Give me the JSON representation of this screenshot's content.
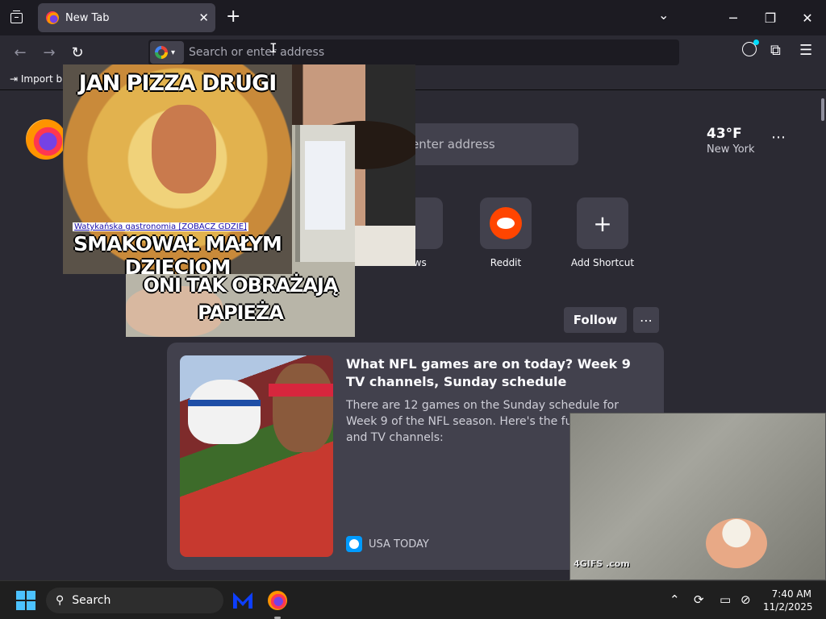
{
  "tabstrip": {
    "tab_title": "New Tab"
  },
  "navbar": {
    "url_placeholder": "Search or enter address"
  },
  "bookmarks": {
    "import_label": "Import b"
  },
  "newtab": {
    "search_placeholder": "enter address",
    "weather": {
      "temp": "43°F",
      "city": "New York"
    },
    "shortcuts": [
      {
        "label": "ews"
      },
      {
        "label": "Reddit"
      },
      {
        "label": "Add Shortcut"
      }
    ],
    "follow_label": "Follow",
    "story": {
      "title": "What NFL games are on today? Week 9 TV channels, Sunday schedule",
      "description": "There are 12 games on the Sunday schedule for Week 9 of the NFL season. Here's the full slate, inc and TV channels:",
      "source": "USA TODAY"
    }
  },
  "overlays": {
    "pizza_top": "JAN PIZZA DRUGI",
    "pizza_link": "Watykańska gastronomia [ZOBACZ GDZIE]",
    "pizza_bottom": "SMAKOWAŁ MAŁYM DZIECIOM",
    "computer_caption": "ONI TAK OBRAŻAJĄ PAPIEŻA",
    "gif_watermark": "4GIFS .com"
  },
  "taskbar": {
    "search_label": "Search",
    "time": "7:40 AM",
    "date": "11/2/2025"
  },
  "colors": {
    "accent": "#00ddff",
    "reddit": "#ff4500",
    "windows_blue": "#4cc2ff"
  }
}
